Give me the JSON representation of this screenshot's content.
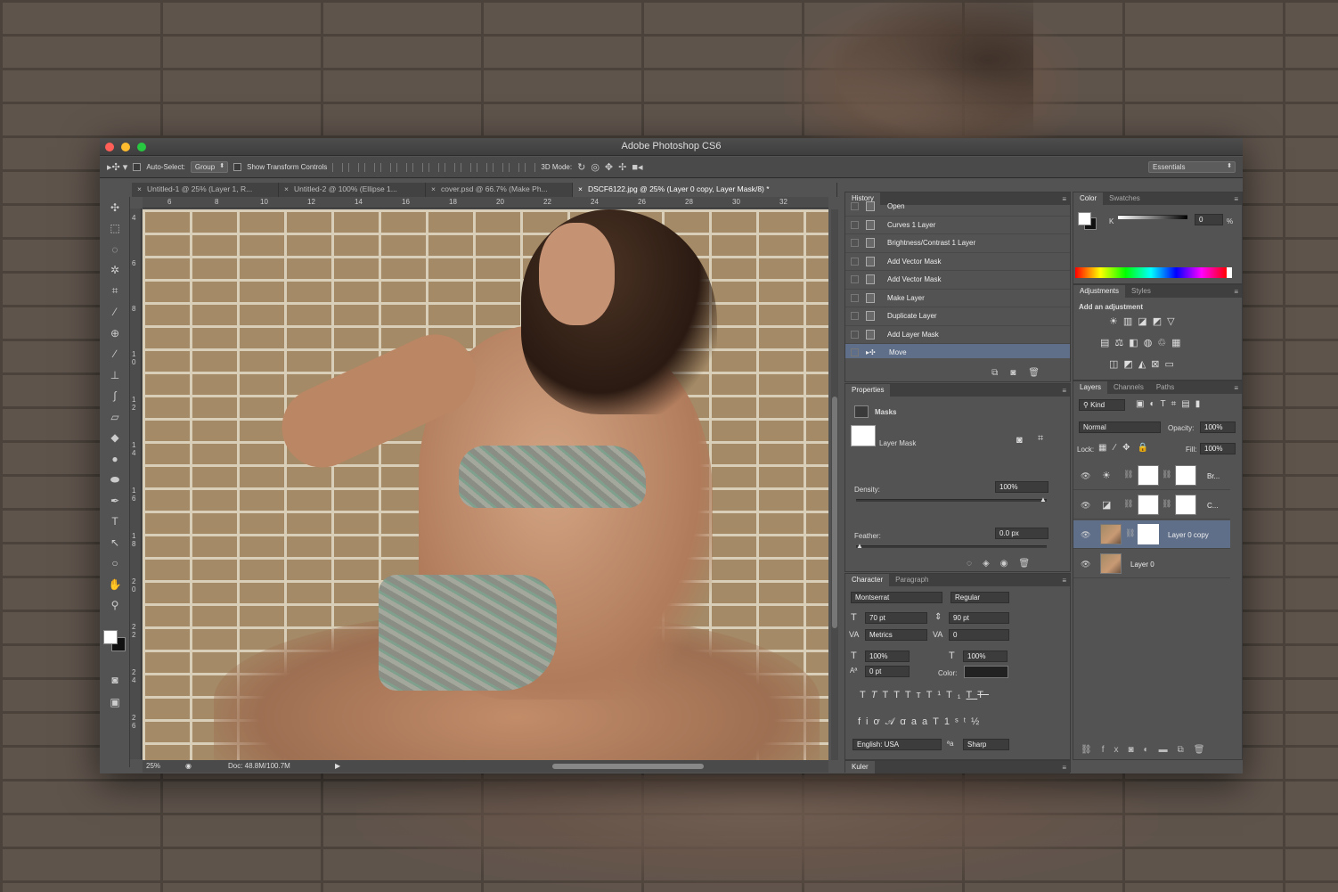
{
  "window": {
    "title": "Adobe Photoshop CS6"
  },
  "options": {
    "auto_select_label": "Auto-Select:",
    "auto_select_value": "Group",
    "show_transform_label": "Show Transform Controls",
    "mode_3d_label": "3D Mode:",
    "workspace": "Essentials"
  },
  "doc_tabs": [
    {
      "label": "Untitled-1 @ 25% (Layer 1, R..."
    },
    {
      "label": "Untitled-2 @ 100% (Ellipse 1..."
    },
    {
      "label": "cover.psd @ 66.7% (Make Ph..."
    },
    {
      "label": "DSCF6122.jpg @ 25% (Layer 0 copy, Layer Mask/8) *"
    }
  ],
  "ruler_top": [
    "6",
    "8",
    "10",
    "12",
    "14",
    "16",
    "18",
    "20",
    "22",
    "24",
    "26",
    "28",
    "30",
    "32"
  ],
  "ruler_left": [
    "4",
    "6",
    "8",
    "1 0",
    "1 2",
    "1 4",
    "1 6",
    "1 8",
    "2 0",
    "2 2",
    "2 4",
    "2 6"
  ],
  "status": {
    "zoom": "25%",
    "doc": "Doc: 48.8M/100.7M"
  },
  "history": {
    "tab": "History",
    "items": [
      "Open",
      "Curves 1 Layer",
      "Brightness/Contrast 1 Layer",
      "Add Vector Mask",
      "Add Vector Mask",
      "Make Layer",
      "Duplicate Layer",
      "Add Layer Mask",
      "Move"
    ]
  },
  "properties": {
    "tab": "Properties",
    "section": "Masks",
    "mask_label": "Layer Mask",
    "density_label": "Density:",
    "density_value": "100%",
    "density_level": 1.0,
    "feather_label": "Feather:",
    "feather_value": "0.0 px",
    "feather_level": 0.0
  },
  "character": {
    "tabs": [
      "Character",
      "Paragraph"
    ],
    "font": "Montserrat",
    "style": "Regular",
    "size": "70 pt",
    "leading": "90 pt",
    "kerning": "Metrics",
    "tracking": "0",
    "vscale": "100%",
    "hscale": "100%",
    "baseline": "0 pt",
    "color_label": "Color:",
    "language": "English: USA",
    "antialias": "Sharp"
  },
  "kuler": {
    "tab": "Kuler"
  },
  "color_panel": {
    "tabs": [
      "Color",
      "Swatches"
    ],
    "channel": "K",
    "value": "0",
    "unit": "%"
  },
  "adjustments": {
    "tabs": [
      "Adjustments",
      "Styles"
    ],
    "heading": "Add an adjustment"
  },
  "layers": {
    "tabs": [
      "Layers",
      "Channels",
      "Paths"
    ],
    "kind": "Kind",
    "blend_mode": "Normal",
    "opacity_label": "Opacity:",
    "opacity": "100%",
    "lock_label": "Lock:",
    "fill_label": "Fill:",
    "fill": "100%",
    "items": [
      {
        "name": "Br...",
        "type": "adjustment",
        "icon": "brightness-icon"
      },
      {
        "name": "C...",
        "type": "adjustment",
        "icon": "curves-icon"
      },
      {
        "name": "Layer 0 copy",
        "type": "photo-mask",
        "selected": true
      },
      {
        "name": "Layer 0",
        "type": "photo"
      }
    ]
  },
  "colors": {
    "selection": "#5f6f8a",
    "panel": "#535353"
  }
}
